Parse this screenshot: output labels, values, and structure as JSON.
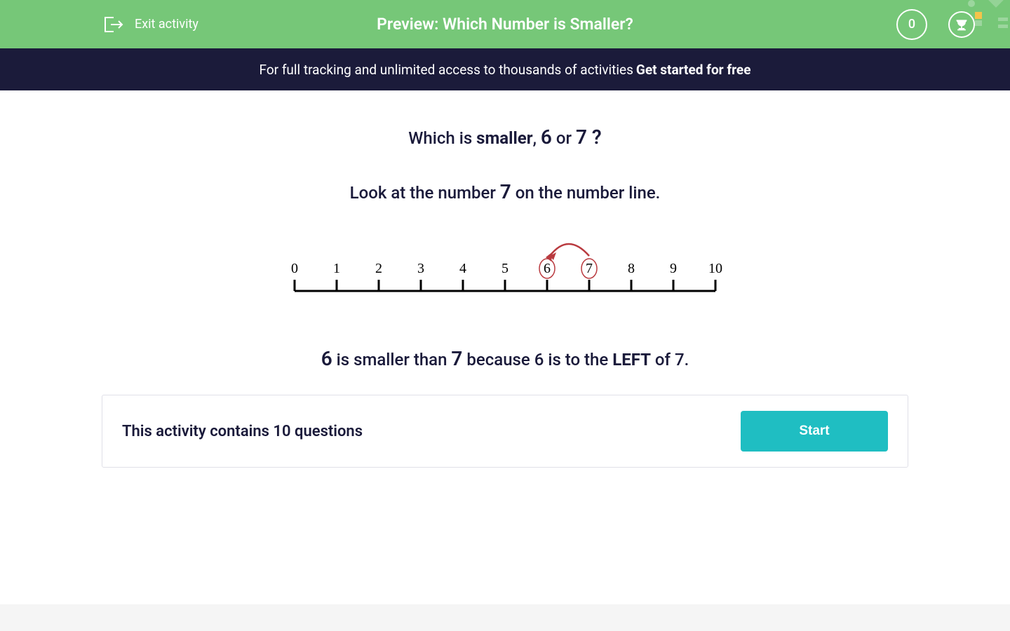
{
  "header": {
    "exit_label": "Exit activity",
    "title": "Preview: Which Number is Smaller?",
    "score": "0"
  },
  "banner": {
    "text": "For full tracking and unlimited access to thousands of activities",
    "link": "Get started for free"
  },
  "question": {
    "prefix": "Which is ",
    "emphasis": "smaller",
    "comma": ", ",
    "num_a": "6",
    "connector": " or ",
    "num_b": "7",
    "suffix": " ?"
  },
  "instruction": {
    "prefix": "Look at the number  ",
    "number": "7",
    "suffix": "  on the number line."
  },
  "number_line": {
    "start": 0,
    "end": 10,
    "ticks": [
      "0",
      "1",
      "2",
      "3",
      "4",
      "5",
      "6",
      "7",
      "8",
      "9",
      "10"
    ],
    "circled": [
      6,
      7
    ],
    "arc_from": 7,
    "arc_to": 6
  },
  "conclusion": {
    "num_a": "6",
    "text1": " is smaller than ",
    "num_b": "7",
    "text2": " because 6 is to the ",
    "emphasis": "LEFT",
    "text3": " of 7."
  },
  "start_panel": {
    "count_text": "This activity contains 10 questions",
    "button": "Start"
  },
  "colors": {
    "green": "#76c778",
    "dark": "#1b1b3a",
    "teal": "#1fbec2",
    "red": "#b93a3f"
  }
}
